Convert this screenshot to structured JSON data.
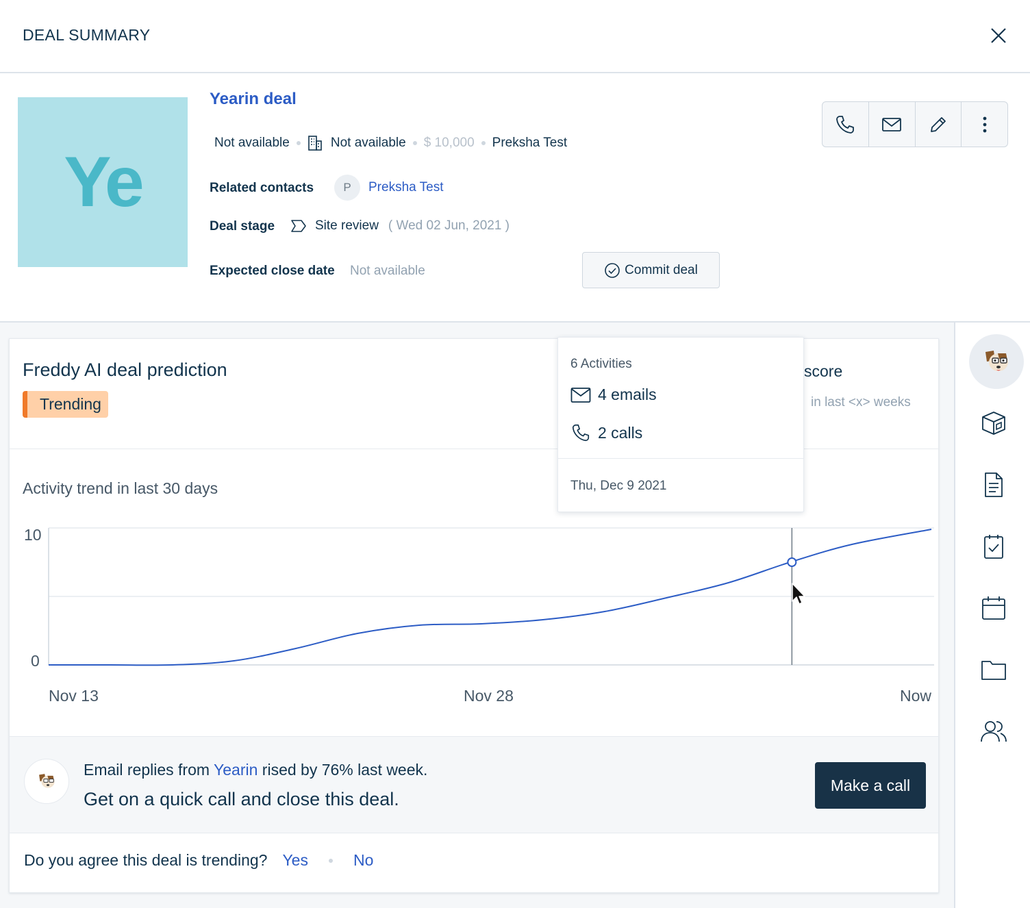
{
  "header": {
    "title": "DEAL SUMMARY"
  },
  "deal": {
    "avatar_initials": "Ye",
    "name": "Yearin deal",
    "meta": {
      "owner": "Not available",
      "company": "Not available",
      "amount": "$ 10,000",
      "contact": "Preksha Test"
    },
    "related_contacts_label": "Related contacts",
    "related_contact_initial": "P",
    "related_contact_name": "Preksha Test",
    "stage_label": "Deal stage",
    "stage_value": "Site review",
    "stage_date": "( Wed 02 Jun, 2021 )",
    "close_date_label": "Expected close date",
    "close_date_value": "Not available",
    "commit_label": "Commit deal"
  },
  "actions": [
    "phone-icon",
    "mail-icon",
    "edit-icon",
    "more-icon"
  ],
  "prediction": {
    "title": "Freddy AI deal prediction",
    "badge": "Trending",
    "score_partial": "score",
    "score_sub": "in last <x> weeks"
  },
  "trend": {
    "title": "Activity trend in last 30 days",
    "y_ticks": [
      "10",
      "0"
    ],
    "x_ticks": [
      "Nov 13",
      "Nov 28",
      "Now"
    ]
  },
  "chart_data": {
    "type": "line",
    "title": "Activity trend in last 30 days",
    "xlabel": "",
    "ylabel": "",
    "ylim": [
      0,
      10
    ],
    "x": [
      0,
      0.07,
      0.14,
      0.21,
      0.28,
      0.35,
      0.42,
      0.49,
      0.56,
      0.63,
      0.7,
      0.77,
      0.84,
      0.91,
      1.0
    ],
    "x_tick_labels": [
      "Nov 13",
      "Nov 28",
      "Now"
    ],
    "series": [
      {
        "values": [
          0,
          0,
          0,
          0.3,
          1.2,
          2.3,
          2.9,
          3.0,
          3.3,
          3.9,
          4.9,
          6.0,
          7.5,
          8.8,
          9.9
        ]
      }
    ],
    "highlight": {
      "x": 0.842,
      "y": 7.5
    },
    "grid": true,
    "accent": "#2c5cc5"
  },
  "tooltip": {
    "count": "6 Activities",
    "emails": "4 emails",
    "calls": "2 calls",
    "date": "Thu, Dec 9 2021"
  },
  "insight": {
    "line1_prefix": "Email replies from ",
    "line1_link": "Yearin",
    "line1_suffix": " rised by 76% last week.",
    "line2": "Get on a quick call and close this deal.",
    "cta": "Make a call"
  },
  "feedback": {
    "question": "Do you agree this deal is trending?",
    "yes": "Yes",
    "no": "No"
  },
  "rail": [
    "freddy-icon",
    "product-icon",
    "document-icon",
    "task-icon",
    "calendar-icon",
    "folder-icon",
    "contacts-icon"
  ]
}
